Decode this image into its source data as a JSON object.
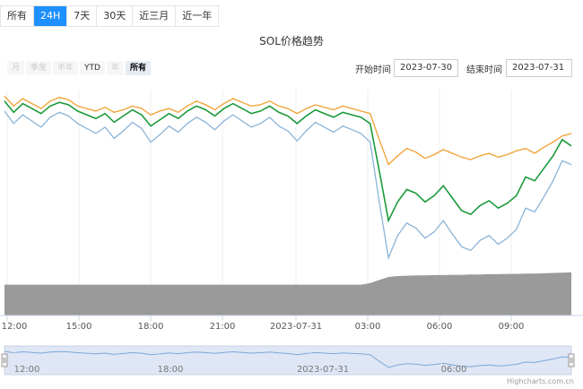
{
  "tabs": [
    {
      "label": "所有",
      "active": false
    },
    {
      "label": "24H",
      "active": true
    },
    {
      "label": "7天",
      "active": false
    },
    {
      "label": "30天",
      "active": false
    },
    {
      "label": "近三月",
      "active": false
    },
    {
      "label": "近一年",
      "active": false
    }
  ],
  "range_buttons": [
    {
      "label": "月",
      "state": "disabled"
    },
    {
      "label": "季度",
      "state": "disabled"
    },
    {
      "label": "半年",
      "state": "disabled"
    },
    {
      "label": "YTD",
      "state": "enabled"
    },
    {
      "label": "年",
      "state": "disabled"
    },
    {
      "label": "所有",
      "state": "selected"
    }
  ],
  "date_range": {
    "start_label": "开始时间",
    "start_value": "2023-07-30",
    "end_label": "结束时间",
    "end_value": "2023-07-31"
  },
  "credit": "Highcharts.com.cn",
  "chart_data": {
    "type": "line",
    "title": "SOL价格趋势",
    "x_ticks": [
      "12:00",
      "15:00",
      "18:00",
      "21:00",
      "2023-07-31",
      "03:00",
      "06:00",
      "09:00"
    ],
    "navigator_ticks": [
      "12:00",
      "18:00",
      "2023-07-31",
      "06:00"
    ],
    "colors": {
      "orange": "#f0a030",
      "green": "#1a9a3a",
      "blue": "#8ab4d8",
      "volume": "#9a9a9a",
      "navigator_line": "#7aa8d8",
      "navigator_fill": "#dfe6f5"
    },
    "series": [
      {
        "values": [
          100.0,
          99.2,
          99.8,
          99.4,
          99.0,
          99.6,
          99.9,
          99.7,
          99.2,
          99.0,
          98.8,
          99.1,
          98.7,
          98.9,
          99.2,
          99.0,
          98.5,
          98.8,
          99.0,
          98.7,
          99.2,
          99.6,
          99.3,
          98.9,
          99.4,
          99.8,
          99.5,
          99.2,
          99.3,
          99.6,
          99.2,
          99.0,
          98.6,
          99.0,
          99.3,
          99.1,
          98.9,
          99.2,
          99.0,
          98.8,
          98.6,
          96.5,
          94.5,
          95.2,
          95.8,
          95.5,
          95.0,
          95.3,
          95.7,
          95.4,
          95.1,
          94.9,
          95.2,
          95.4,
          95.1,
          95.3,
          95.6,
          95.8,
          95.4,
          95.9,
          96.3,
          96.8,
          97.0
        ]
      },
      {
        "values": [
          99.6,
          98.7,
          99.4,
          99.0,
          98.6,
          99.2,
          99.5,
          99.3,
          98.8,
          98.5,
          98.2,
          98.6,
          97.9,
          98.4,
          98.9,
          98.5,
          97.6,
          98.1,
          98.6,
          98.2,
          98.8,
          99.2,
          98.9,
          98.4,
          99.0,
          99.4,
          99.0,
          98.6,
          98.8,
          99.2,
          98.7,
          98.4,
          97.8,
          98.4,
          98.9,
          98.6,
          98.3,
          98.7,
          98.5,
          98.3,
          97.8,
          94.0,
          90.0,
          91.5,
          92.5,
          92.2,
          91.5,
          92.0,
          92.8,
          91.8,
          90.8,
          90.5,
          91.2,
          91.6,
          91.0,
          91.4,
          92.0,
          93.5,
          93.2,
          94.2,
          95.2,
          96.5,
          96.0
        ]
      },
      {
        "values": [
          98.8,
          97.8,
          98.5,
          98.0,
          97.5,
          98.3,
          98.7,
          98.4,
          97.8,
          97.4,
          97.0,
          97.5,
          96.6,
          97.2,
          97.9,
          97.4,
          96.3,
          96.9,
          97.6,
          97.1,
          97.8,
          98.3,
          97.9,
          97.3,
          98.0,
          98.5,
          98.0,
          97.5,
          97.8,
          98.3,
          97.6,
          97.2,
          96.4,
          97.2,
          97.9,
          97.5,
          97.1,
          97.6,
          97.3,
          97.0,
          96.3,
          91.5,
          87.0,
          88.8,
          89.8,
          89.4,
          88.6,
          89.1,
          90.0,
          88.9,
          87.9,
          87.6,
          88.4,
          88.8,
          88.1,
          88.6,
          89.3,
          91.0,
          90.7,
          91.9,
          93.2,
          94.8,
          94.5
        ]
      }
    ],
    "volume": [
      10,
      10,
      10,
      10,
      10,
      10,
      10,
      10,
      10,
      10,
      10,
      10,
      10,
      10,
      10,
      10,
      10,
      10,
      10,
      10,
      10,
      10,
      10,
      10,
      10,
      10,
      10,
      10,
      10,
      10,
      10,
      10,
      10,
      10,
      10,
      10,
      10,
      10,
      10,
      10,
      10.5,
      11.5,
      12.5,
      12.8,
      12.9,
      13.0,
      13.0,
      13.1,
      13.1,
      13.2,
      13.2,
      13.3,
      13.3,
      13.4,
      13.4,
      13.5,
      13.5,
      13.6,
      13.6,
      13.7,
      13.8,
      13.9,
      14.0
    ],
    "grid": true,
    "legend": "none"
  }
}
